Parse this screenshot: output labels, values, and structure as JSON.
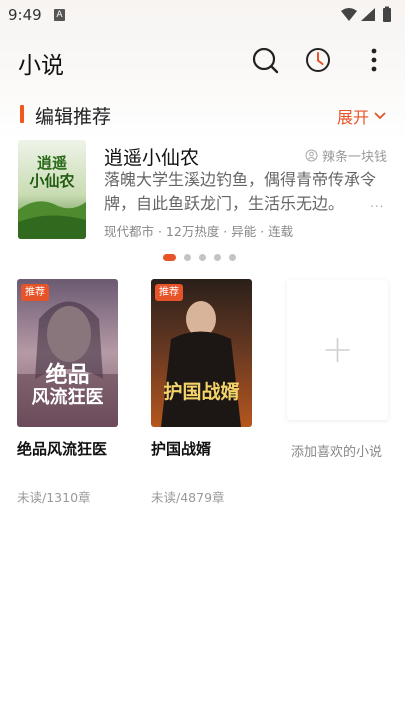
{
  "status_bar": {
    "time": "9:49",
    "notification_icon": "A"
  },
  "header": {
    "title": "小说"
  },
  "section": {
    "title": "编辑推荐",
    "expand_label": "展开"
  },
  "recommended": {
    "title": "逍遥小仙农",
    "author": "辣条一块钱",
    "description": "落魄大学生溪边钓鱼，偶得青帝传承令牌，自此鱼跃龙门，生活乐无边。",
    "more": "...",
    "meta": "现代都市 · 12万热度 · 异能 · 连载",
    "cover_text_line1": "逍遥",
    "cover_text_line2": "小仙农"
  },
  "carousel": {
    "count": 5,
    "active_index": 0
  },
  "shelf": {
    "books": [
      {
        "badge": "推荐",
        "title": "绝品风流狂医",
        "progress": "未读/1310章",
        "cover_line1": "绝品",
        "cover_line2": "风流狂医"
      },
      {
        "badge": "推荐",
        "title": "护国战婿",
        "progress": "未读/4879章",
        "cover_line1": "护国战婿",
        "cover_line2": ""
      }
    ],
    "add_label": "添加喜欢的小说"
  },
  "colors": {
    "accent": "#e8542a",
    "section_bar": "#f2581e"
  },
  "icons": [
    "search-icon",
    "history-clock-icon",
    "more-vert-icon",
    "chevron-down-icon",
    "author-icon",
    "add-plus-icon",
    "wifi-icon",
    "signal-icon",
    "battery-icon"
  ]
}
